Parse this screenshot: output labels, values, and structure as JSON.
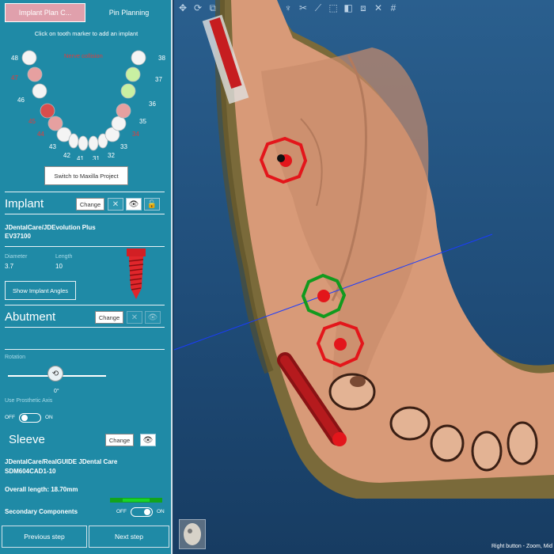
{
  "tabs": {
    "implant_plan": "Implant Plan C...",
    "pin_planning": "Pin Planning"
  },
  "instruction": "Click on tooth marker to add an implant",
  "chart": {
    "nerve_label": "Nerve collision",
    "teeth": [
      {
        "num": "48",
        "red": false
      },
      {
        "num": "47",
        "red": true
      },
      {
        "num": "46",
        "red": false
      },
      {
        "num": "45",
        "red": true
      },
      {
        "num": "44",
        "red": true
      },
      {
        "num": "43",
        "red": false
      },
      {
        "num": "42",
        "red": false
      },
      {
        "num": "41",
        "red": false
      },
      {
        "num": "31",
        "red": false
      },
      {
        "num": "32",
        "red": false
      },
      {
        "num": "33",
        "red": false
      },
      {
        "num": "34",
        "red": true
      },
      {
        "num": "35",
        "red": false
      },
      {
        "num": "36",
        "red": false
      },
      {
        "num": "37",
        "red": false
      },
      {
        "num": "38",
        "red": false
      }
    ]
  },
  "switch_button": "Switch to Maxilla Project",
  "implant": {
    "title": "Implant",
    "change": "Change",
    "brand": "JDentalCare/JDEvolution Plus",
    "code": "EV37100",
    "diameter_label": "Diameter",
    "diameter_value": "3.7",
    "length_label": "Length",
    "length_value": "10",
    "show_angles": "Show Implant Angles"
  },
  "abutment": {
    "title": "Abutment",
    "change": "Change",
    "rotation_label": "Rotation",
    "rotation_value": "0°",
    "prosthetic_axis": "Use Prosthetic Axis",
    "off": "OFF",
    "on": "ON"
  },
  "sleeve": {
    "title": "Sleeve",
    "change": "Change",
    "brand": "JDentalCare/RealGUIDE JDental Care",
    "code": "SDM604CAD1-10",
    "overall_length": "Overall length: 18.70mm"
  },
  "secondary": {
    "label": "Secondary Components",
    "off": "OFF",
    "on": "ON"
  },
  "nav": {
    "previous": "Previous step",
    "next": "Next step"
  },
  "statusbar": "Right button - Zoom, Mid",
  "toolbar_icons": [
    "move-icon",
    "rotate-icon",
    "clip-icon",
    "skull-icon",
    "undo-icon",
    "panorama-icon",
    "crosshair-icon",
    "tooth-icon",
    "cut-icon",
    "measure-icon",
    "ruler-icon",
    "camera-icon",
    "layers-icon",
    "view-icon",
    "hash-icon"
  ],
  "colors": {
    "panel": "#1f8aa6",
    "collision": "#e3161b",
    "ok": "#129a1e",
    "bone": "#d89a78"
  }
}
